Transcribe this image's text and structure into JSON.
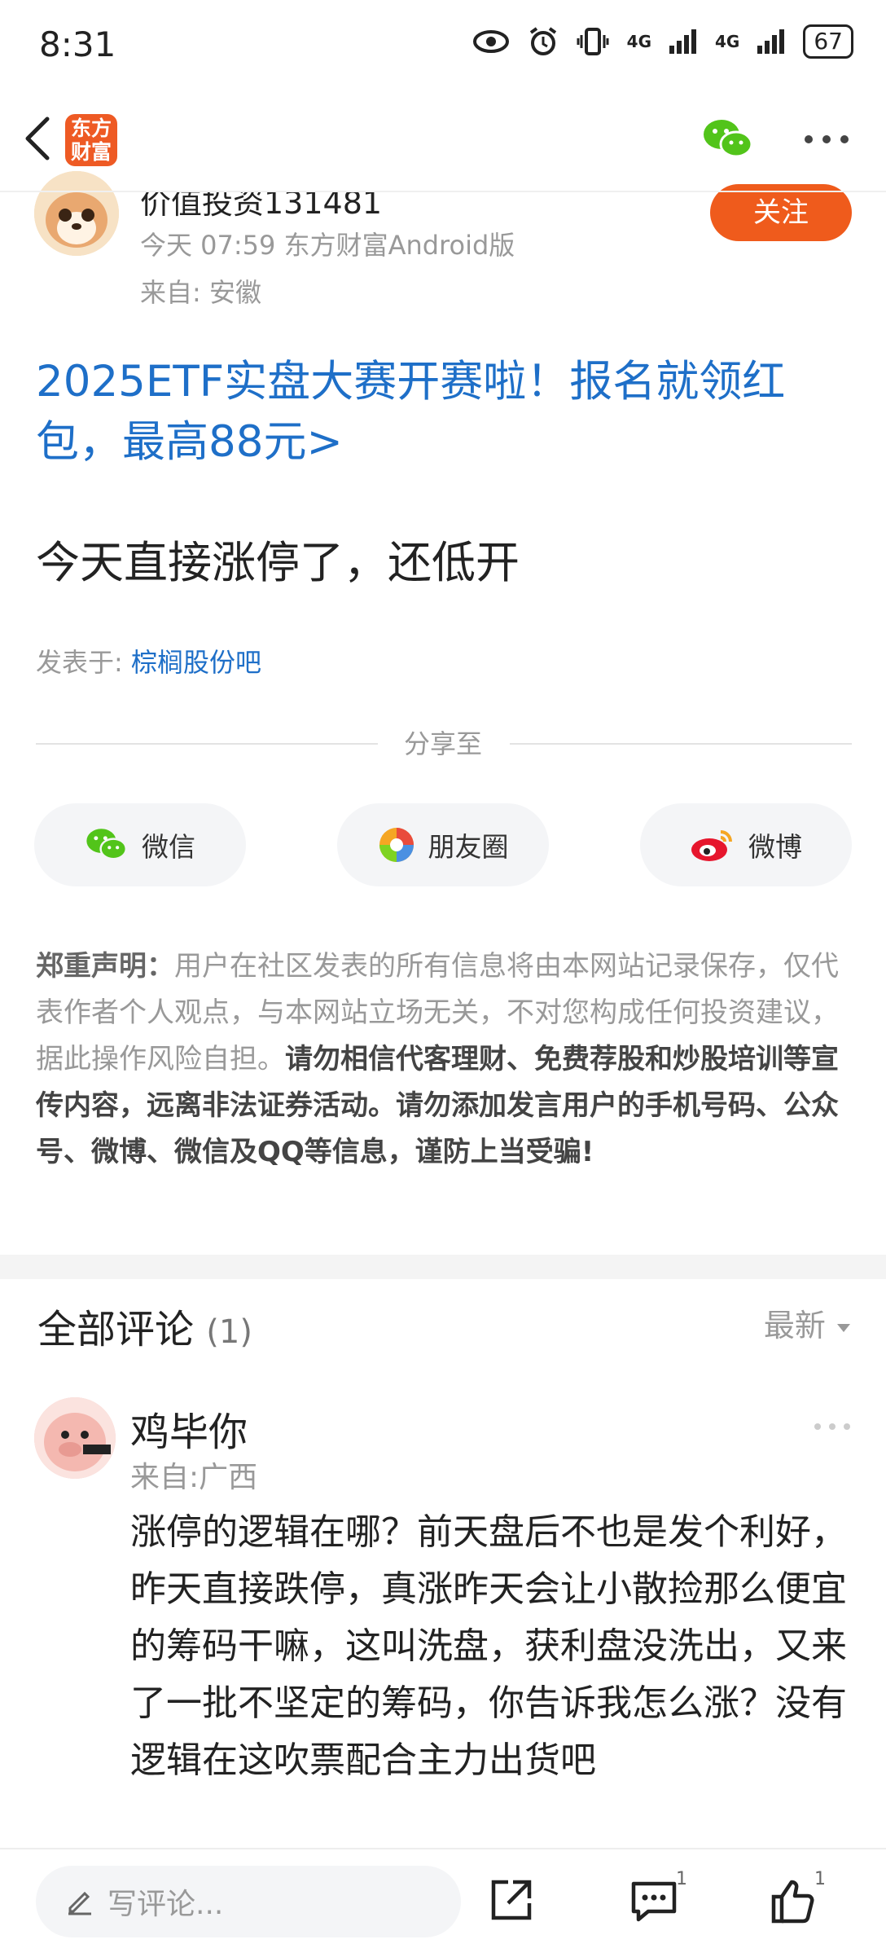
{
  "status_bar": {
    "time": "8:31",
    "signal1": "4G",
    "signal2": "4G",
    "battery": "67"
  },
  "app_bar": {
    "logo_line1": "东方",
    "logo_line2": "财富"
  },
  "post": {
    "author_name": "价值投资131481",
    "meta": "今天 07:59 东方财富Android版",
    "location": "来自: 安徽",
    "follow_label": "关注",
    "promo": "2025ETF实盘大赛开赛啦！报名就领红包，最高88元>",
    "body": "今天直接涨停了，还低开",
    "posted_in_label": "发表于: ",
    "posted_in_board": "棕榈股份吧"
  },
  "share": {
    "title": "分享至",
    "wechat": "微信",
    "moments": "朋友圈",
    "weibo": "微博"
  },
  "disclaimer": {
    "head": "郑重声明：",
    "text": "用户在社区发表的所有信息将由本网站记录保存，仅代表作者个人观点，与本网站立场无关，不对您构成任何投资建议，据此操作风险自担。",
    "strong": "请勿相信代客理财、免费荐股和炒股培训等宣传内容，远离非法证券活动。请勿添加发言用户的手机号码、公众号、微博、微信及QQ等信息，谨防上当受骗!"
  },
  "comments": {
    "title": "全部评论",
    "count": "(1)",
    "sort": "最新",
    "items": [
      {
        "name": "鸡毕你",
        "location": "来自:广西",
        "text": "涨停的逻辑在哪？前天盘后不也是发个利好，昨天直接跌停，真涨昨天会让小散捡那么便宜的筹码干嘛，这叫洗盘，获利盘没洗出，又来了一批不坚定的筹码，你告诉我怎么涨？没有逻辑在这吹票配合主力出货吧"
      }
    ]
  },
  "bottom_bar": {
    "input_placeholder": "写评论...",
    "comment_badge": "1",
    "like_badge": "1"
  },
  "colors": {
    "accent_orange": "#ef5b1c",
    "link_blue": "#1e6fc8"
  }
}
